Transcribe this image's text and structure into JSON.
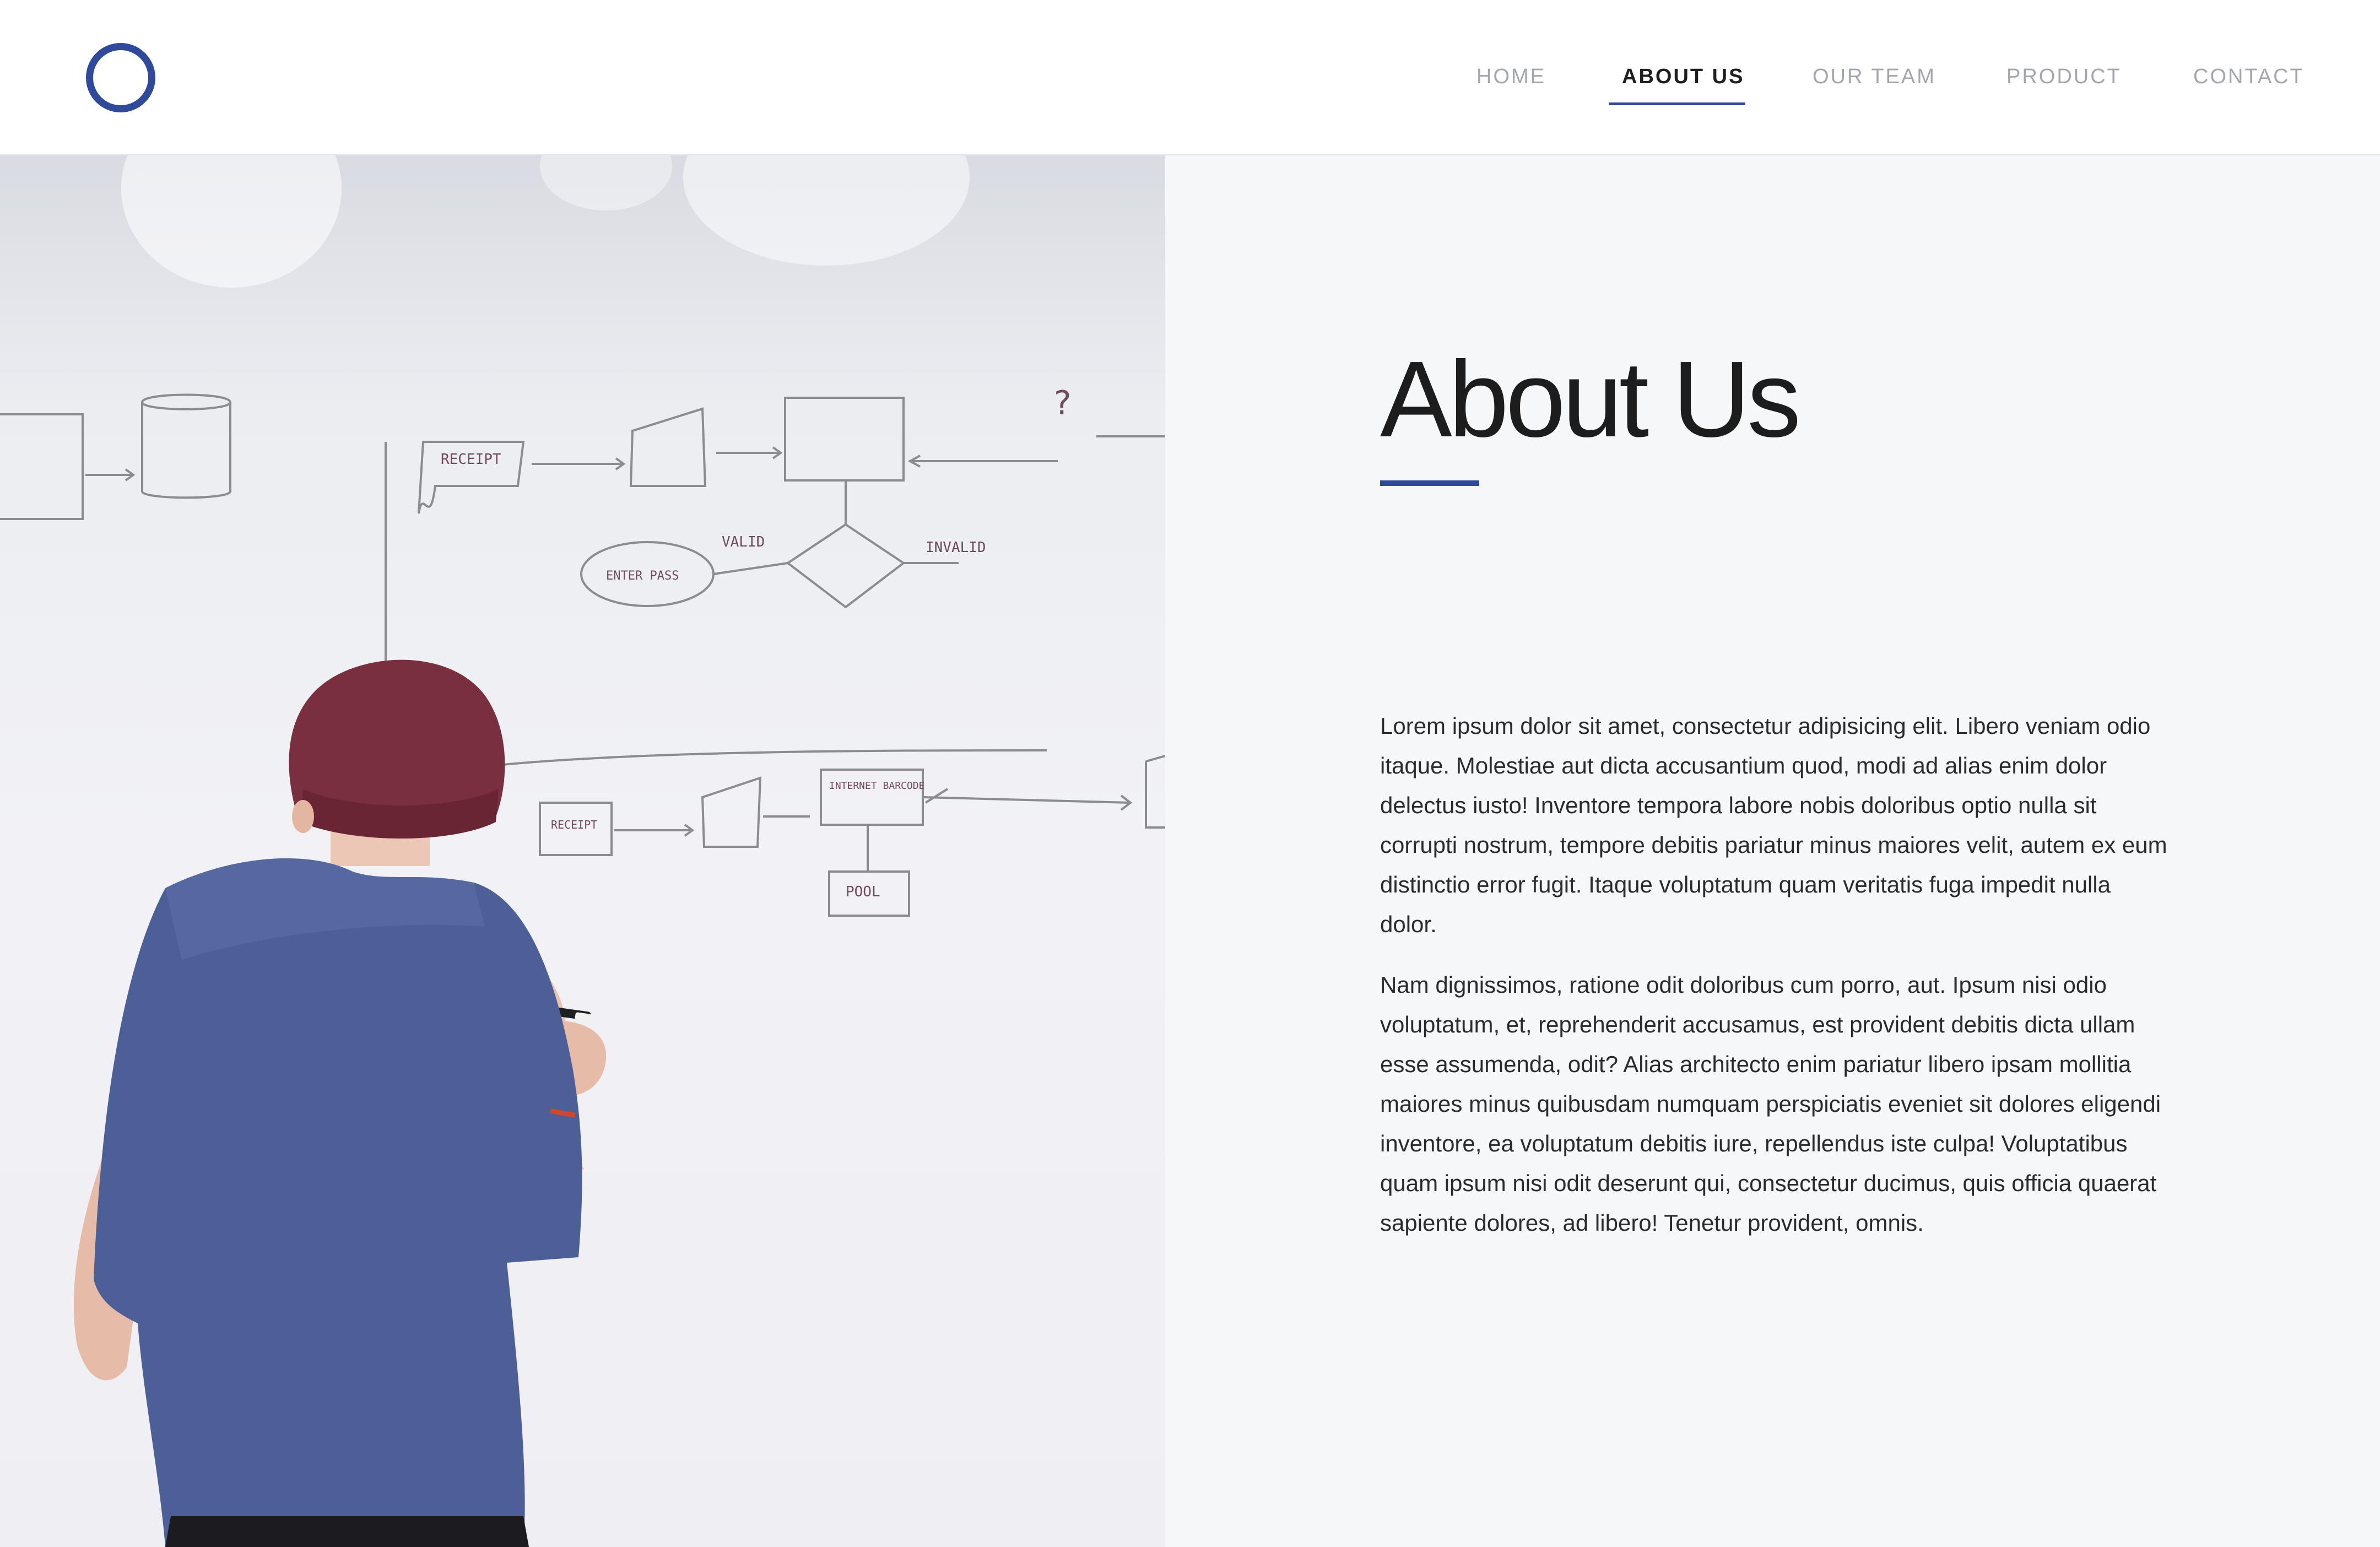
{
  "header": {
    "logo": "ring-logo",
    "nav": [
      {
        "label": "HOME",
        "active": false
      },
      {
        "label": "ABOUT US",
        "active": true
      },
      {
        "label": "OUR TEAM",
        "active": false
      },
      {
        "label": "PRODUCT",
        "active": false
      },
      {
        "label": "CONTACT",
        "active": false
      }
    ]
  },
  "hero_image": {
    "whiteboard_labels": [
      "RECEIPT",
      "ENTER PASS",
      "VALID",
      "INVALID",
      "?",
      "RECEIPT",
      "INTERNET BARCODE",
      "POOL"
    ]
  },
  "about": {
    "title": "About Us",
    "paragraphs": [
      "Lorem ipsum dolor sit amet, consectetur adipisicing elit. Libero veniam odio itaque. Molestiae aut dicta accusantium quod, modi ad alias enim dolor delectus iusto! Inventore tempora labore nobis doloribus optio nulla sit corrupti nostrum, tempore debitis pariatur minus maiores velit, autem ex eum distinctio error fugit. Itaque voluptatum quam veritatis fuga impedit nulla dolor.",
      "Nam dignissimos, ratione odit doloribus cum porro, aut. Ipsum nisi odio voluptatum, et, reprehenderit accusamus, est provident debitis dicta ullam esse assumenda, odit? Alias architecto enim pariatur libero ipsam mollitia maiores minus quibusdam numquam perspiciatis eveniet sit dolores eligendi inventore, ea voluptatum debitis iure, repellendus iste culpa! Voluptatibus quam ipsum nisi odit deserunt qui, consectetur ducimus, quis officia quaerat sapiente dolores, ad libero! Tenetur provident, omnis."
    ]
  },
  "colors": {
    "accent": "#2f4a9b",
    "nav_inactive": "#a3a6ad",
    "nav_active": "#1f1f1f",
    "content_bg": "#f6f7f9"
  }
}
